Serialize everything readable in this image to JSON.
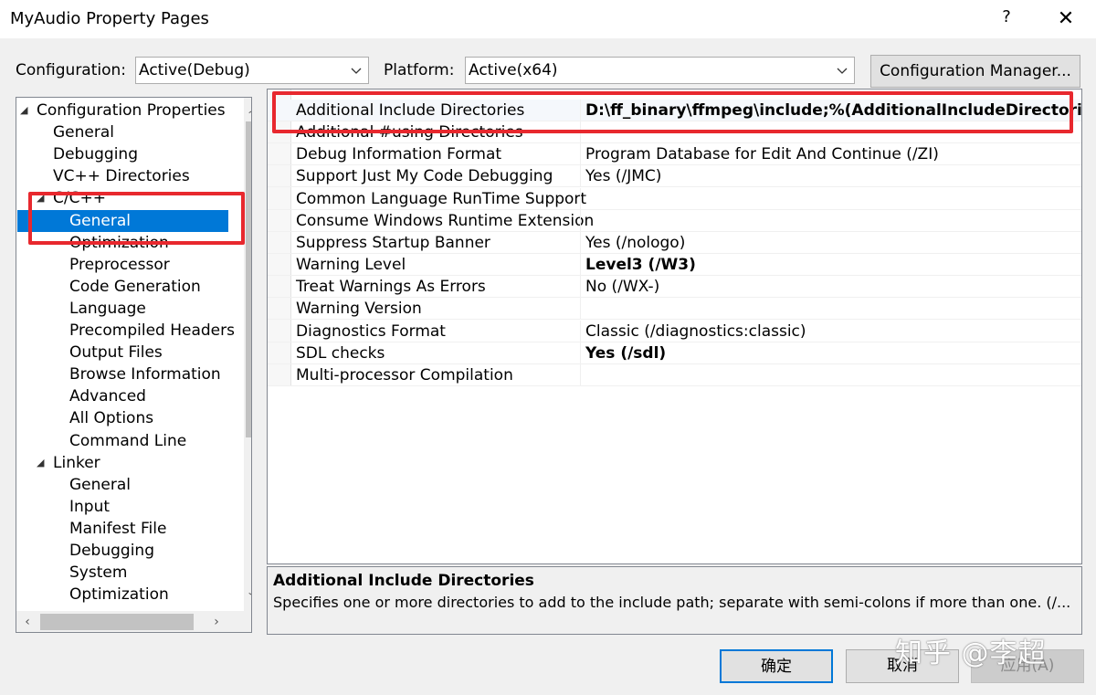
{
  "window": {
    "title": "MyAudio Property Pages",
    "help": "?",
    "close": "✕"
  },
  "config_bar": {
    "configuration_label": "Configuration:",
    "configuration_value": "Active(Debug)",
    "platform_label": "Platform:",
    "platform_value": "Active(x64)",
    "manager_button": "Configuration Manager..."
  },
  "tree": {
    "items": [
      {
        "label": "Configuration Properties",
        "expander": "◢"
      },
      {
        "label": "General"
      },
      {
        "label": "Debugging"
      },
      {
        "label": "VC++ Directories"
      },
      {
        "label": "C/C++",
        "expander": "◢"
      },
      {
        "label": "General",
        "selected": true
      },
      {
        "label": "Optimization"
      },
      {
        "label": "Preprocessor"
      },
      {
        "label": "Code Generation"
      },
      {
        "label": "Language"
      },
      {
        "label": "Precompiled Headers"
      },
      {
        "label": "Output Files"
      },
      {
        "label": "Browse Information"
      },
      {
        "label": "Advanced"
      },
      {
        "label": "All Options"
      },
      {
        "label": "Command Line"
      },
      {
        "label": "Linker",
        "expander": "◢"
      },
      {
        "label": "General"
      },
      {
        "label": "Input"
      },
      {
        "label": "Manifest File"
      },
      {
        "label": "Debugging"
      },
      {
        "label": "System"
      },
      {
        "label": "Optimization"
      }
    ]
  },
  "properties": [
    {
      "name": "Additional Include Directories",
      "value": "D:\\ff_binary\\ffmpeg\\include;%(AdditionalIncludeDirectories)",
      "bold": true
    },
    {
      "name": "Additional #using Directories",
      "value": ""
    },
    {
      "name": "Debug Information Format",
      "value": "Program Database for Edit And Continue (/ZI)"
    },
    {
      "name": "Support Just My Code Debugging",
      "value": "Yes (/JMC)"
    },
    {
      "name": "Common Language RunTime Support",
      "value": ""
    },
    {
      "name": "Consume Windows Runtime Extension",
      "value": ""
    },
    {
      "name": "Suppress Startup Banner",
      "value": "Yes (/nologo)"
    },
    {
      "name": "Warning Level",
      "value": "Level3 (/W3)",
      "bold": true
    },
    {
      "name": "Treat Warnings As Errors",
      "value": "No (/WX-)"
    },
    {
      "name": "Warning Version",
      "value": ""
    },
    {
      "name": "Diagnostics Format",
      "value": "Classic (/diagnostics:classic)"
    },
    {
      "name": "SDL checks",
      "value": "Yes (/sdl)",
      "bold": true
    },
    {
      "name": "Multi-processor Compilation",
      "value": ""
    }
  ],
  "description": {
    "title": "Additional Include Directories",
    "text": "Specifies one or more directories to add to the include path; separate with semi-colons if more than one.    (/..."
  },
  "buttons": {
    "ok": "确定",
    "cancel": "取消",
    "apply": "应用(A)"
  },
  "watermark": "知乎 @李超",
  "colors": {
    "selection": "#0078d7",
    "highlight_box": "#e8282e"
  }
}
